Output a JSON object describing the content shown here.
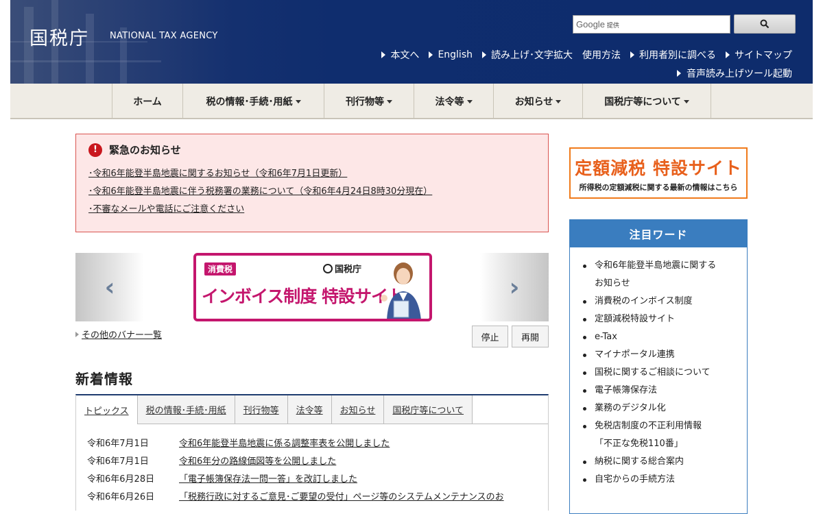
{
  "header": {
    "logo_jp": "国税庁",
    "logo_en": "NATIONAL TAX AGENCY",
    "search_placeholder": "Google",
    "search_provided": "提供",
    "utility_links": [
      "本文へ",
      "English",
      "読み上げ･文字拡大",
      "使用方法",
      "利用者別に調べる",
      "サイトマップ"
    ],
    "voice_tool": "音声読み上げツール起動"
  },
  "gnav": {
    "items": [
      "ホーム",
      "税の情報･手続･用紙",
      "刊行物等",
      "法令等",
      "お知らせ",
      "国税庁等について"
    ]
  },
  "alert": {
    "title": "緊急のお知らせ",
    "links": [
      "･令和6年能登半島地震に関するお知らせ（令和6年7月1日更新）",
      "･令和6年能登半島地震に伴う税務署の業務について（令和6年4月24日8時30分現在）",
      "･不審なメールや電話にご注意ください"
    ]
  },
  "banner": {
    "tag": "消費税",
    "agency": "国税庁",
    "title": "インボイス制度 特設サイト",
    "other_banners": "その他のバナー一覧",
    "stop": "停止",
    "resume": "再開"
  },
  "news": {
    "heading": "新着情報",
    "tabs": [
      "トピックス",
      "税の情報･手続･用紙",
      "刊行物等",
      "法令等",
      "お知らせ",
      "国税庁等について"
    ],
    "items": [
      {
        "date": "令和6年7月1日",
        "text": "令和6年能登半島地震に係る調整率表を公開しました"
      },
      {
        "date": "令和6年7月1日",
        "text": "令和6年分の路線価図等を公開しました"
      },
      {
        "date": "令和6年6月28日",
        "text": "「電子帳簿保存法一問一答」を改訂しました"
      },
      {
        "date": "令和6年6月26日",
        "text": "「税務行政に対するご意見･ご要望の受付」ページ等のシステムメンテナンスのお"
      }
    ]
  },
  "sidebar": {
    "teigaku_title": "定額減税 特設サイト",
    "teigaku_sub": "所得税の定額減税に関する最新の情報はこちら",
    "keywords_title": "注目ワード",
    "keywords": [
      "令和6年能登半島地震に関するお知らせ",
      "消費税のインボイス制度",
      "定額減税特設サイト",
      "e-Tax",
      "マイナポータル連携",
      "国税に関するご相談について",
      "電子帳簿保存法",
      "業務のデジタル化",
      "免税店制度の不正利用情報「不正な免税110番」",
      "納税に関する総合案内",
      "自宅からの手続方法"
    ]
  },
  "colors": {
    "header_bg": "#0e2c6c",
    "alert_border": "#d9534f",
    "alert_bg": "#fde7e7",
    "banner_accent": "#c4166d",
    "teigaku_orange": "#e8601c",
    "keywords_blue": "#3a7dbf"
  }
}
